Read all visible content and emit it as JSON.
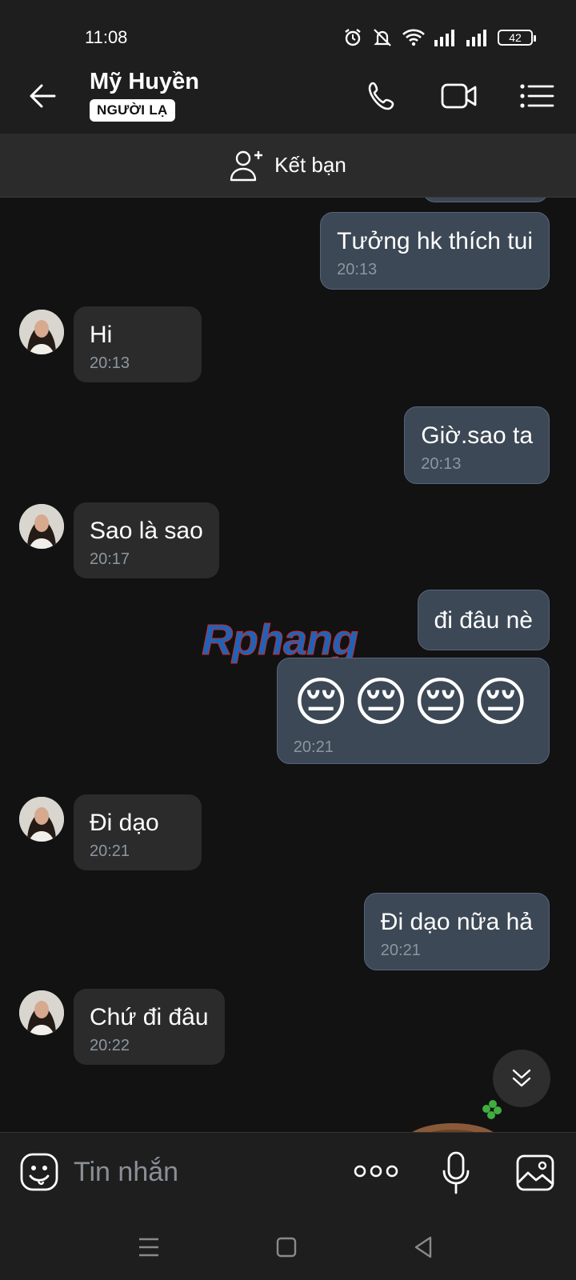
{
  "status_bar": {
    "time": "11:08",
    "battery": "42"
  },
  "header": {
    "name": "Mỹ Huyền",
    "badge": "NGƯỜI LẠ"
  },
  "friend_bar": {
    "label": "Kết bạn"
  },
  "messages": [
    {
      "side": "sent",
      "text": "Tưởng hk thích tui",
      "time": "20:13"
    },
    {
      "side": "received",
      "text": "Hi",
      "time": "20:13"
    },
    {
      "side": "sent",
      "text": "Giờ.sao ta",
      "time": "20:13"
    },
    {
      "side": "received",
      "text": "Sao là sao",
      "time": "20:17"
    },
    {
      "side": "sent",
      "text": "đi đâu nè",
      "time": ""
    },
    {
      "side": "sent",
      "text": "😔😔😔😔",
      "time": "20:21"
    },
    {
      "side": "received",
      "text": "Đi dạo",
      "time": "20:21"
    },
    {
      "side": "sent",
      "text": "Đi dạo nữa hả",
      "time": "20:21"
    },
    {
      "side": "received",
      "text": "Chứ đi đâu",
      "time": "20:22"
    }
  ],
  "watermark": {
    "text": "Rphang"
  },
  "composer": {
    "placeholder": "Tin nhắn"
  },
  "colors": {
    "sent_bubble": "#3c4855",
    "received_bubble": "#2b2b2b",
    "background": "#121212"
  },
  "icons": [
    "alarm-icon",
    "mute-icon",
    "wifi-icon",
    "signal-icon",
    "back-arrow-icon",
    "phone-icon",
    "video-icon",
    "menu-icon",
    "add-friend-icon",
    "scroll-down-icon",
    "emoji-icon",
    "more-icon",
    "mic-icon",
    "image-icon"
  ]
}
